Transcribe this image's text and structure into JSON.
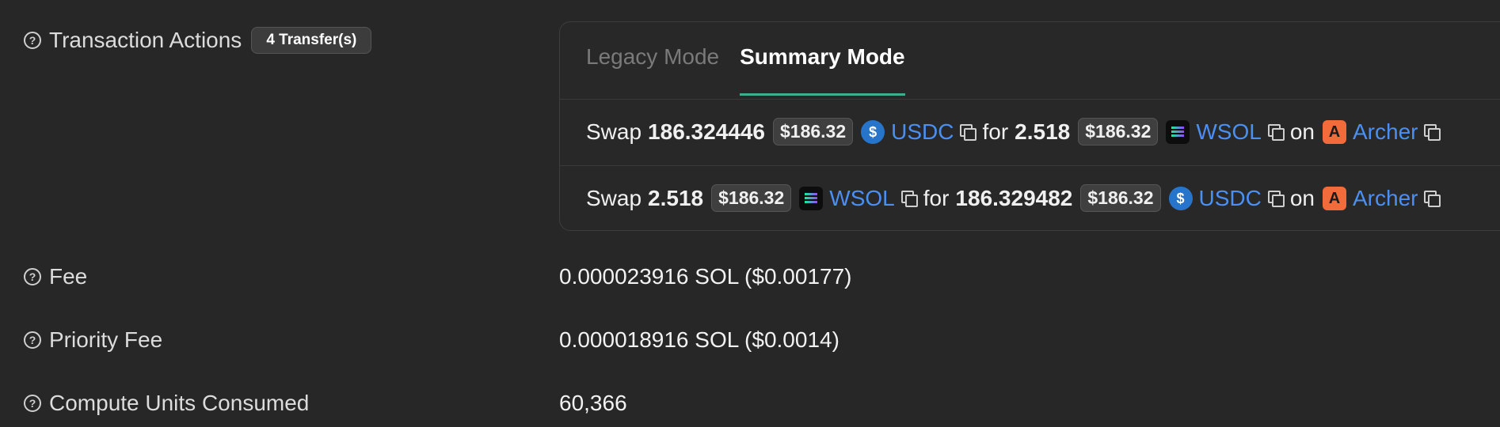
{
  "actions": {
    "label": "Transaction Actions",
    "badge": "4 Transfer(s)",
    "tabs": [
      {
        "label": "Legacy Mode",
        "active": false
      },
      {
        "label": "Summary Mode",
        "active": true
      }
    ],
    "swaps": [
      {
        "swap_word": "Swap",
        "in_amount": "186.324446",
        "in_price": "$186.32",
        "in_token": "USDC",
        "for_word": "for",
        "out_amount": "2.518",
        "out_price": "$186.32",
        "out_token": "WSOL",
        "on_word": "on",
        "protocol": "Archer"
      },
      {
        "swap_word": "Swap",
        "in_amount": "2.518",
        "in_price": "$186.32",
        "in_token": "WSOL",
        "for_word": "for",
        "out_amount": "186.329482",
        "out_price": "$186.32",
        "out_token": "USDC",
        "on_word": "on",
        "protocol": "Archer"
      }
    ]
  },
  "fee": {
    "label": "Fee",
    "value": "0.000023916 SOL ($0.00177)"
  },
  "priority_fee": {
    "label": "Priority Fee",
    "value": "0.000018916 SOL ($0.0014)"
  },
  "compute_units": {
    "label": "Compute Units Consumed",
    "value": "60,366"
  },
  "colors": {
    "accent": "#3fae8e",
    "link": "#4c8ff2",
    "background": "#272727"
  }
}
